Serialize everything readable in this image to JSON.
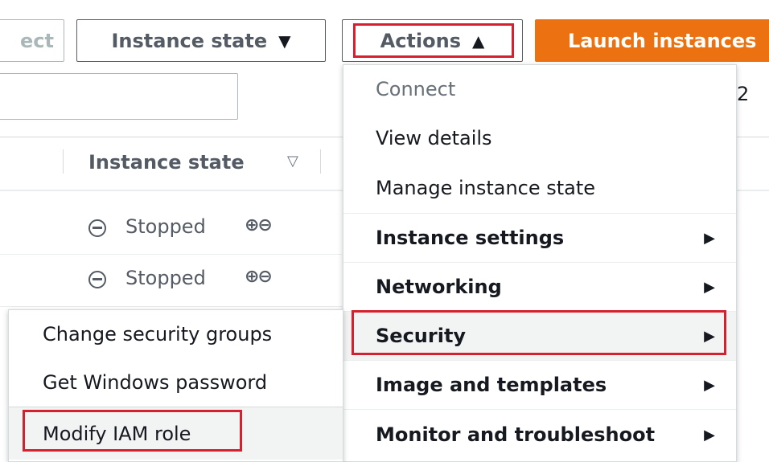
{
  "toolbar": {
    "partial_button_label": "ect",
    "instance_state_label": "Instance state",
    "actions_label": "Actions",
    "launch_label": "Launch instances",
    "page_number_partial": "2"
  },
  "table": {
    "column_header": "Instance state",
    "rows": [
      {
        "state": "Stopped"
      },
      {
        "state": "Stopped"
      }
    ]
  },
  "actions_menu": {
    "items": [
      {
        "label": "Connect"
      },
      {
        "label": "View details"
      },
      {
        "label": "Manage instance state"
      },
      {
        "label": "Instance settings"
      },
      {
        "label": "Networking"
      },
      {
        "label": "Security"
      },
      {
        "label": "Image and templates"
      },
      {
        "label": "Monitor and troubleshoot"
      }
    ]
  },
  "security_submenu": {
    "items": [
      {
        "label": "Change security groups"
      },
      {
        "label": "Get Windows password"
      },
      {
        "label": "Modify IAM role"
      }
    ]
  },
  "colors": {
    "primary": "#ec7211",
    "highlight": "#d5202f",
    "text": "#16191f",
    "muted": "#545b64"
  }
}
